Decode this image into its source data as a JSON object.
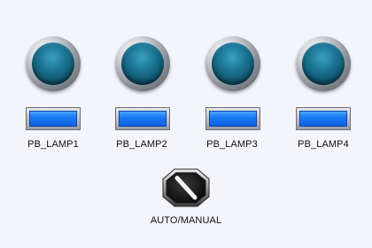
{
  "lamps": [
    {
      "label": "PB_LAMP1",
      "icon": "indicator-lamp-icon"
    },
    {
      "label": "PB_LAMP2",
      "icon": "indicator-lamp-icon"
    },
    {
      "label": "PB_LAMP3",
      "icon": "indicator-lamp-icon"
    },
    {
      "label": "PB_LAMP4",
      "icon": "indicator-lamp-icon"
    }
  ],
  "selector": {
    "label": "AUTO/MANUAL",
    "icon": "selector-switch-icon"
  },
  "colors": {
    "background": "#f4f4fc",
    "lamp_lens": "#0d4c63",
    "button_face": "#1a7af5"
  }
}
